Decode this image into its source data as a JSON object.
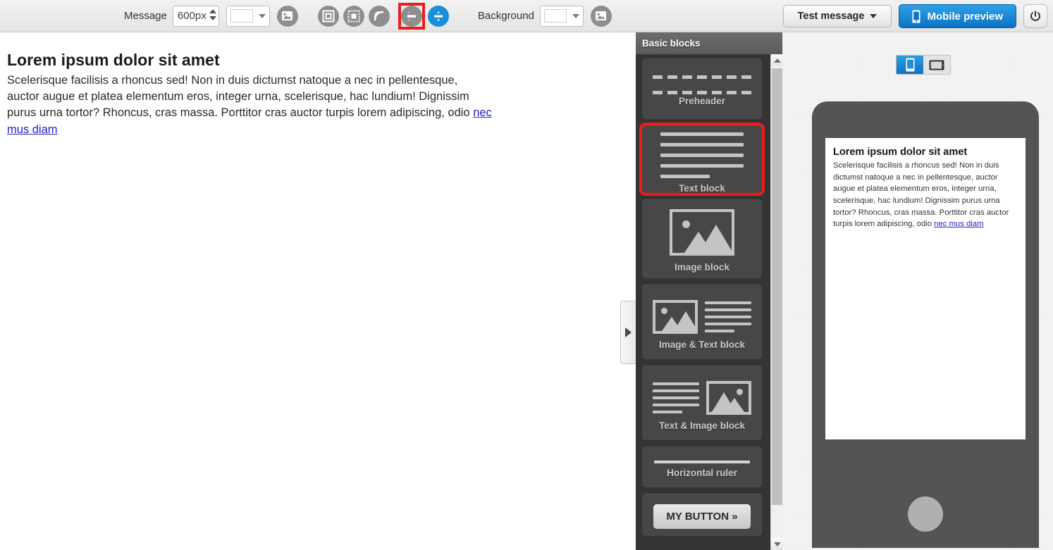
{
  "toolbar": {
    "message_label": "Message",
    "width_value": "600px",
    "width_swatch_color": "#ffffff",
    "background_label": "Background",
    "background_swatch_color": "#ffffff",
    "icons": {
      "message_bg_image": "image-icon",
      "padding": "padding-icon",
      "border": "border-icon",
      "rounded_corners": "rounded-corners-icon",
      "split_horizontal": "split-horizontal-icon",
      "split_vertical": "split-vertical-icon",
      "background_image": "image-icon"
    },
    "test_message_label": "Test message",
    "mobile_preview_label": "Mobile preview",
    "power_label": "",
    "selected_tool": "split-horizontal-icon",
    "highlight_color": "#ee1b1b",
    "accent_color": "#1a8fd8"
  },
  "canvas": {
    "title": "Lorem ipsum dolor sit amet",
    "paragraph": "Scelerisque facilisis a rhoncus sed! Non in duis dictumst natoque a nec in pellentesque, auctor augue et platea elementum eros, integer urna, scelerisque, hac lundium! Dignissim purus urna tortor? Rhoncus, cras massa. Porttitor cras auctor turpis lorem adipiscing, odio ",
    "link_text": "nec mus diam"
  },
  "blocks_panel": {
    "header": "Basic blocks",
    "selected_block": "Text block",
    "items": [
      {
        "label": "Preheader",
        "art": "dashed-lines"
      },
      {
        "label": "Text block",
        "art": "text-lines",
        "selected": true
      },
      {
        "label": "Image block",
        "art": "image"
      },
      {
        "label": "Image & Text block",
        "art": "image-text"
      },
      {
        "label": "Text & Image block",
        "art": "text-image"
      },
      {
        "label": "Horizontal ruler",
        "art": "rule"
      },
      {
        "label": "MY BUTTON »",
        "art": "button"
      }
    ]
  },
  "preview": {
    "orientation": "portrait",
    "portrait_icon": "phone-portrait-icon",
    "landscape_icon": "phone-landscape-icon",
    "title": "Lorem ipsum dolor sit amet",
    "paragraph": "Scelerisque facilisis a rhoncus sed! Non in duis dictumst natoque a nec in pellentesque, auctor augue et platea elementum eros, integer urna, scelerisque, hac lundium! Dignissim purus urna tortor? Rhoncus, cras massa. Porttitor cras auctor turpis lorem adipiscing, odio ",
    "link_text": "nec mus diam"
  },
  "collapse_handle": {
    "icon": "chevron-right-icon"
  }
}
